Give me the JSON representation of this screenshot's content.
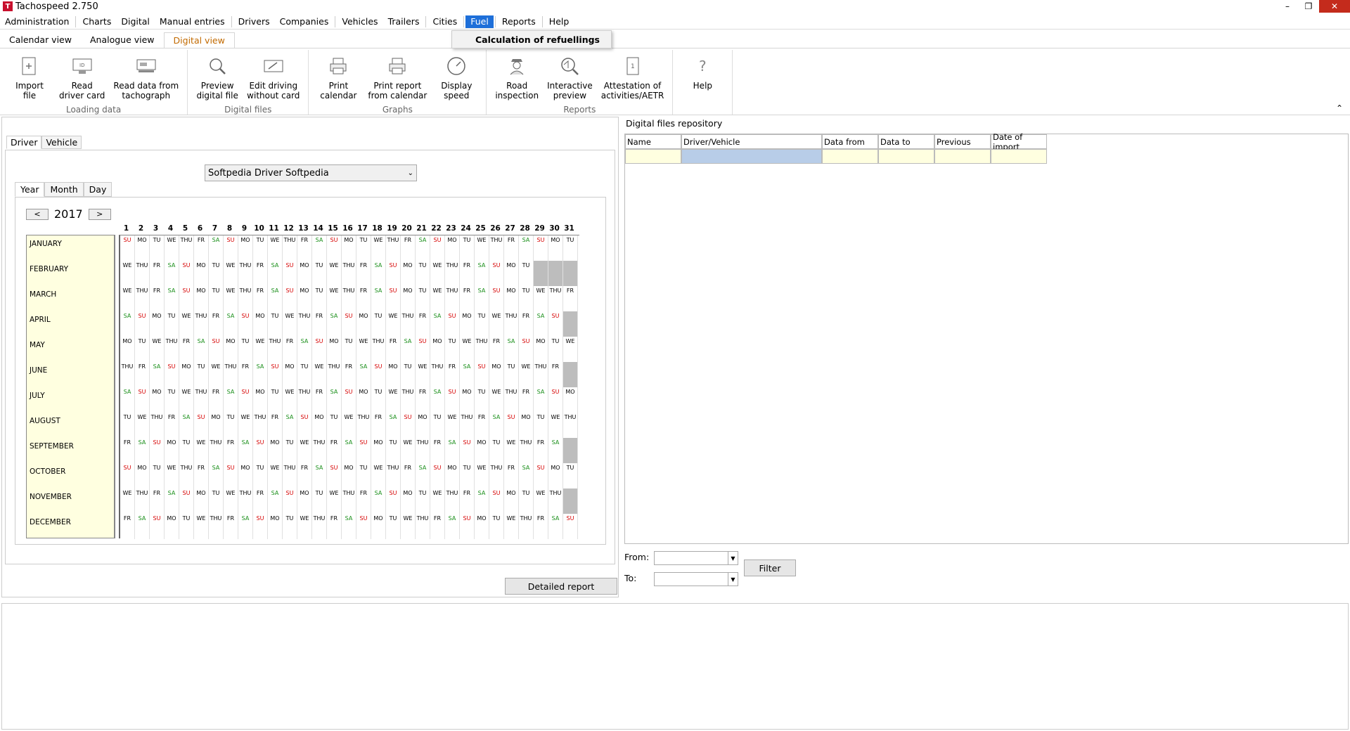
{
  "window": {
    "title": "Tachospeed 2.750"
  },
  "menu": {
    "items": [
      "Administration",
      "Charts",
      "Digital",
      "Manual entries",
      "Drivers",
      "Companies",
      "Vehicles",
      "Trailers",
      "Cities",
      "Fuel",
      "Reports",
      "Help"
    ],
    "active": "Fuel",
    "dropdown_item": "Calculation of refuellings"
  },
  "ribbon": {
    "tabs": [
      "Calendar view",
      "Analogue view",
      "Digital view"
    ],
    "active_tab": "Digital view",
    "groups": [
      {
        "label": "Loading data",
        "buttons": [
          "Import\nfile",
          "Read\ndriver card",
          "Read data from\ntachograph"
        ]
      },
      {
        "label": "Digital files",
        "buttons": [
          "Preview\ndigital file",
          "Edit driving\nwithout card"
        ]
      },
      {
        "label": "Graphs",
        "buttons": [
          "Print\ncalendar",
          "Print report\nfrom calendar",
          "Display\nspeed"
        ]
      },
      {
        "label": "Reports",
        "buttons": [
          "Road\ninspection",
          "Interactive\npreview",
          "Attestation of\nactivities/AETR"
        ]
      },
      {
        "label": "",
        "buttons": [
          "Help"
        ]
      }
    ]
  },
  "left": {
    "tabs": [
      "Driver",
      "Vehicle"
    ],
    "driver_select": "Softpedia Driver Softpedia",
    "period_tabs": [
      "Year",
      "Month",
      "Day"
    ],
    "year": "2017",
    "prev": "<",
    "next": ">",
    "days_header": [
      "1",
      "2",
      "3",
      "4",
      "5",
      "6",
      "7",
      "8",
      "9",
      "10",
      "11",
      "12",
      "13",
      "14",
      "15",
      "16",
      "17",
      "18",
      "19",
      "20",
      "21",
      "22",
      "23",
      "24",
      "25",
      "26",
      "27",
      "28",
      "29",
      "30",
      "31"
    ],
    "months": [
      "JANUARY",
      "FEBRUARY",
      "MARCH",
      "APRIL",
      "MAY",
      "JUNE",
      "JULY",
      "AUGUST",
      "SEPTEMBER",
      "OCTOBER",
      "NOVEMBER",
      "DECEMBER"
    ],
    "detailed_report": "Detailed report"
  },
  "right": {
    "title": "Digital files repository",
    "columns": [
      "Name",
      "Driver/Vehicle",
      "Data from",
      "Data to",
      "Previous",
      "Date of import"
    ],
    "filter": {
      "from_label": "From:",
      "to_label": "To:",
      "button": "Filter"
    }
  },
  "colors": {
    "weekend_sat": "#1a8f1a",
    "weekend_sun": "#d60000",
    "accent": "#1e6fd9"
  }
}
